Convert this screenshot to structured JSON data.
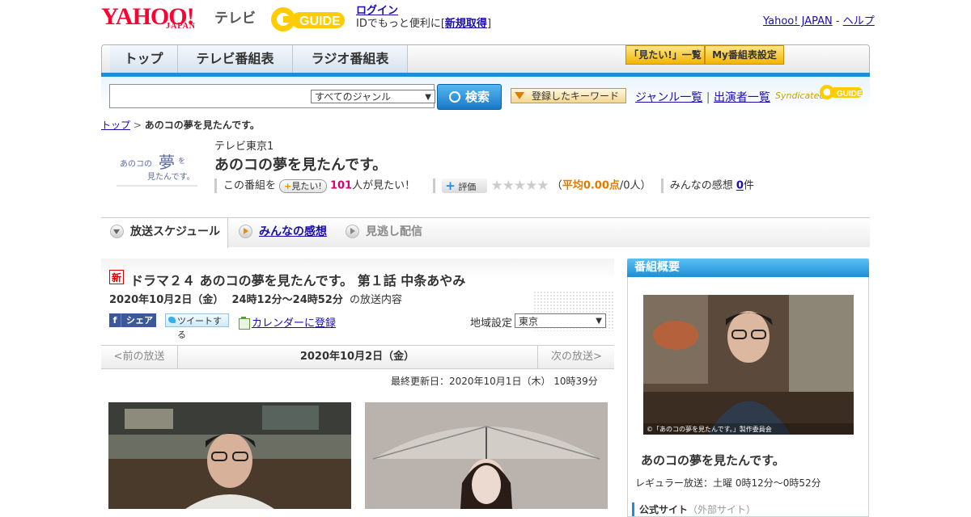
{
  "header": {
    "yahoo_logo": "YAHOO!",
    "japan_logo": "JAPAN",
    "tv_label": "テレビ",
    "gguide_logo": "GUIDE",
    "login_link": "ログイン",
    "login_prompt": "IDでもっと便利に[",
    "register_link": "新規取得",
    "register_close": "]",
    "yahoo_japan_link": "Yahoo! JAPAN",
    "help_sep": "-",
    "help_link": "ヘルプ"
  },
  "nav": {
    "tabs": [
      {
        "label": "トップ"
      },
      {
        "label": "テレビ番組表"
      },
      {
        "label": "ラジオ番組表"
      }
    ],
    "want_list": "「見たい!」一覧",
    "my_settings": "My番組表設定"
  },
  "search": {
    "placeholder": "",
    "genre_selected": "すべてのジャンル",
    "search_button": "検索",
    "keyword_button": "登録したキーワード",
    "genre_list_link": "ジャンル一覧",
    "divider": "|",
    "performer_link": "出演者一覧",
    "syndicated": "Syndicated"
  },
  "breadcrumb": {
    "top": "トップ",
    "sep": ">",
    "current": "あのコの夢を見たんです。"
  },
  "program": {
    "channel": "テレビ東京1",
    "title": "あのコの夢を見たんです。",
    "this_program": "この番組を",
    "mitai_btn": "見たい!",
    "mitai_count": "101",
    "mitai_suffix": "人が見たい！",
    "rating_btn": "評価",
    "stars": "★★★★★",
    "avg_open": "（",
    "avg_label": "平均0.00点",
    "avg_people": "/0人）",
    "impressions_label": "みんなの感想",
    "impressions_count": "0",
    "impressions_unit": "件"
  },
  "tabs": {
    "schedule": "放送スケジュール",
    "impressions": "みんなの感想",
    "missed": "見逃し配信"
  },
  "episode": {
    "new_badge": "新",
    "title": "ドラマ２４ あのコの夢を見たんです。 第１話 中条あやみ",
    "date": "2020年10月2日（金）",
    "time": "24時12分～24時52分",
    "suffix": "の放送内容",
    "share_fb_letter": "f",
    "share_fb": "シェア",
    "tweet": "ツイートする",
    "calendar": "カレンダーに登録",
    "region_label": "地域設定",
    "region_value": "東京"
  },
  "pager": {
    "prev": "<前の放送",
    "date": "2020年10月2日（金）",
    "next": "次の放送>"
  },
  "updated": "最終更新日：2020年10月1日（木） 10時39分",
  "sidebar": {
    "heading": "番組概要",
    "copyright": "©「あのコの夢を見たんです。」製作委員会",
    "title": "あのコの夢を見たんです。",
    "regular": "レギュラー放送：土曜 0時12分～0時52分",
    "official": "公式サイト",
    "official_note": "（外部サイト）"
  },
  "colors": {
    "accent_blue": "#1a8ed8",
    "yahoo_red": "#ff0033",
    "mitai_pink": "#d60072",
    "rating_orange": "#e07b00"
  }
}
